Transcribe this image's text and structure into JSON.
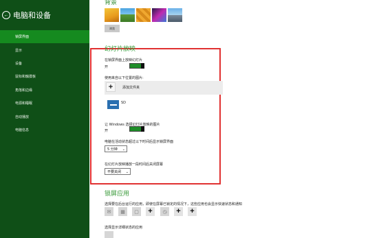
{
  "sidebar": {
    "title": "电脑和设备",
    "items": [
      {
        "label": "锁屏界面",
        "active": true
      },
      {
        "label": "显示"
      },
      {
        "label": "设备"
      },
      {
        "label": "鼠标和触摸板"
      },
      {
        "label": "角落和边缘"
      },
      {
        "label": "电源和睡眠"
      },
      {
        "label": "自动播放"
      },
      {
        "label": "电脑信息"
      }
    ]
  },
  "main": {
    "top_partial_title": "背景",
    "browse_label": "浏览",
    "slideshow_title": "幻灯片放映",
    "play_slideshow_label": "在锁屏界面上放映幻灯片",
    "play_slideshow_state": "开",
    "source_label": "使用来自以下位置的图片:",
    "add_folder_label": "添加文件夹",
    "sd_label": "SD",
    "windows_pick_label": "让 Windows 选择幻灯片放映的图片",
    "windows_pick_state": "开",
    "inactive_label": "电脑在活动状态超过以下时间后显示锁屏界面",
    "inactive_value": "5 分钟",
    "screen_off_label": "在幻灯片放映播放一段时间后关闭屏幕",
    "screen_off_value": "不要关闭",
    "lock_apps_title": "锁屏应用",
    "lock_apps_desc": "选择要在后台运行的应用，即使在屏幕已锁定的情况下，这些应用也会显示快速状态和通知",
    "detailed_status_label": "选择显示详细状态的应用"
  },
  "colors": {
    "sidebar_bg": "#0f4f17",
    "sidebar_active": "#158a1f",
    "accent_green": "#1e8d28",
    "title_green": "#3a9a3a",
    "highlight_red": "#e03030"
  }
}
